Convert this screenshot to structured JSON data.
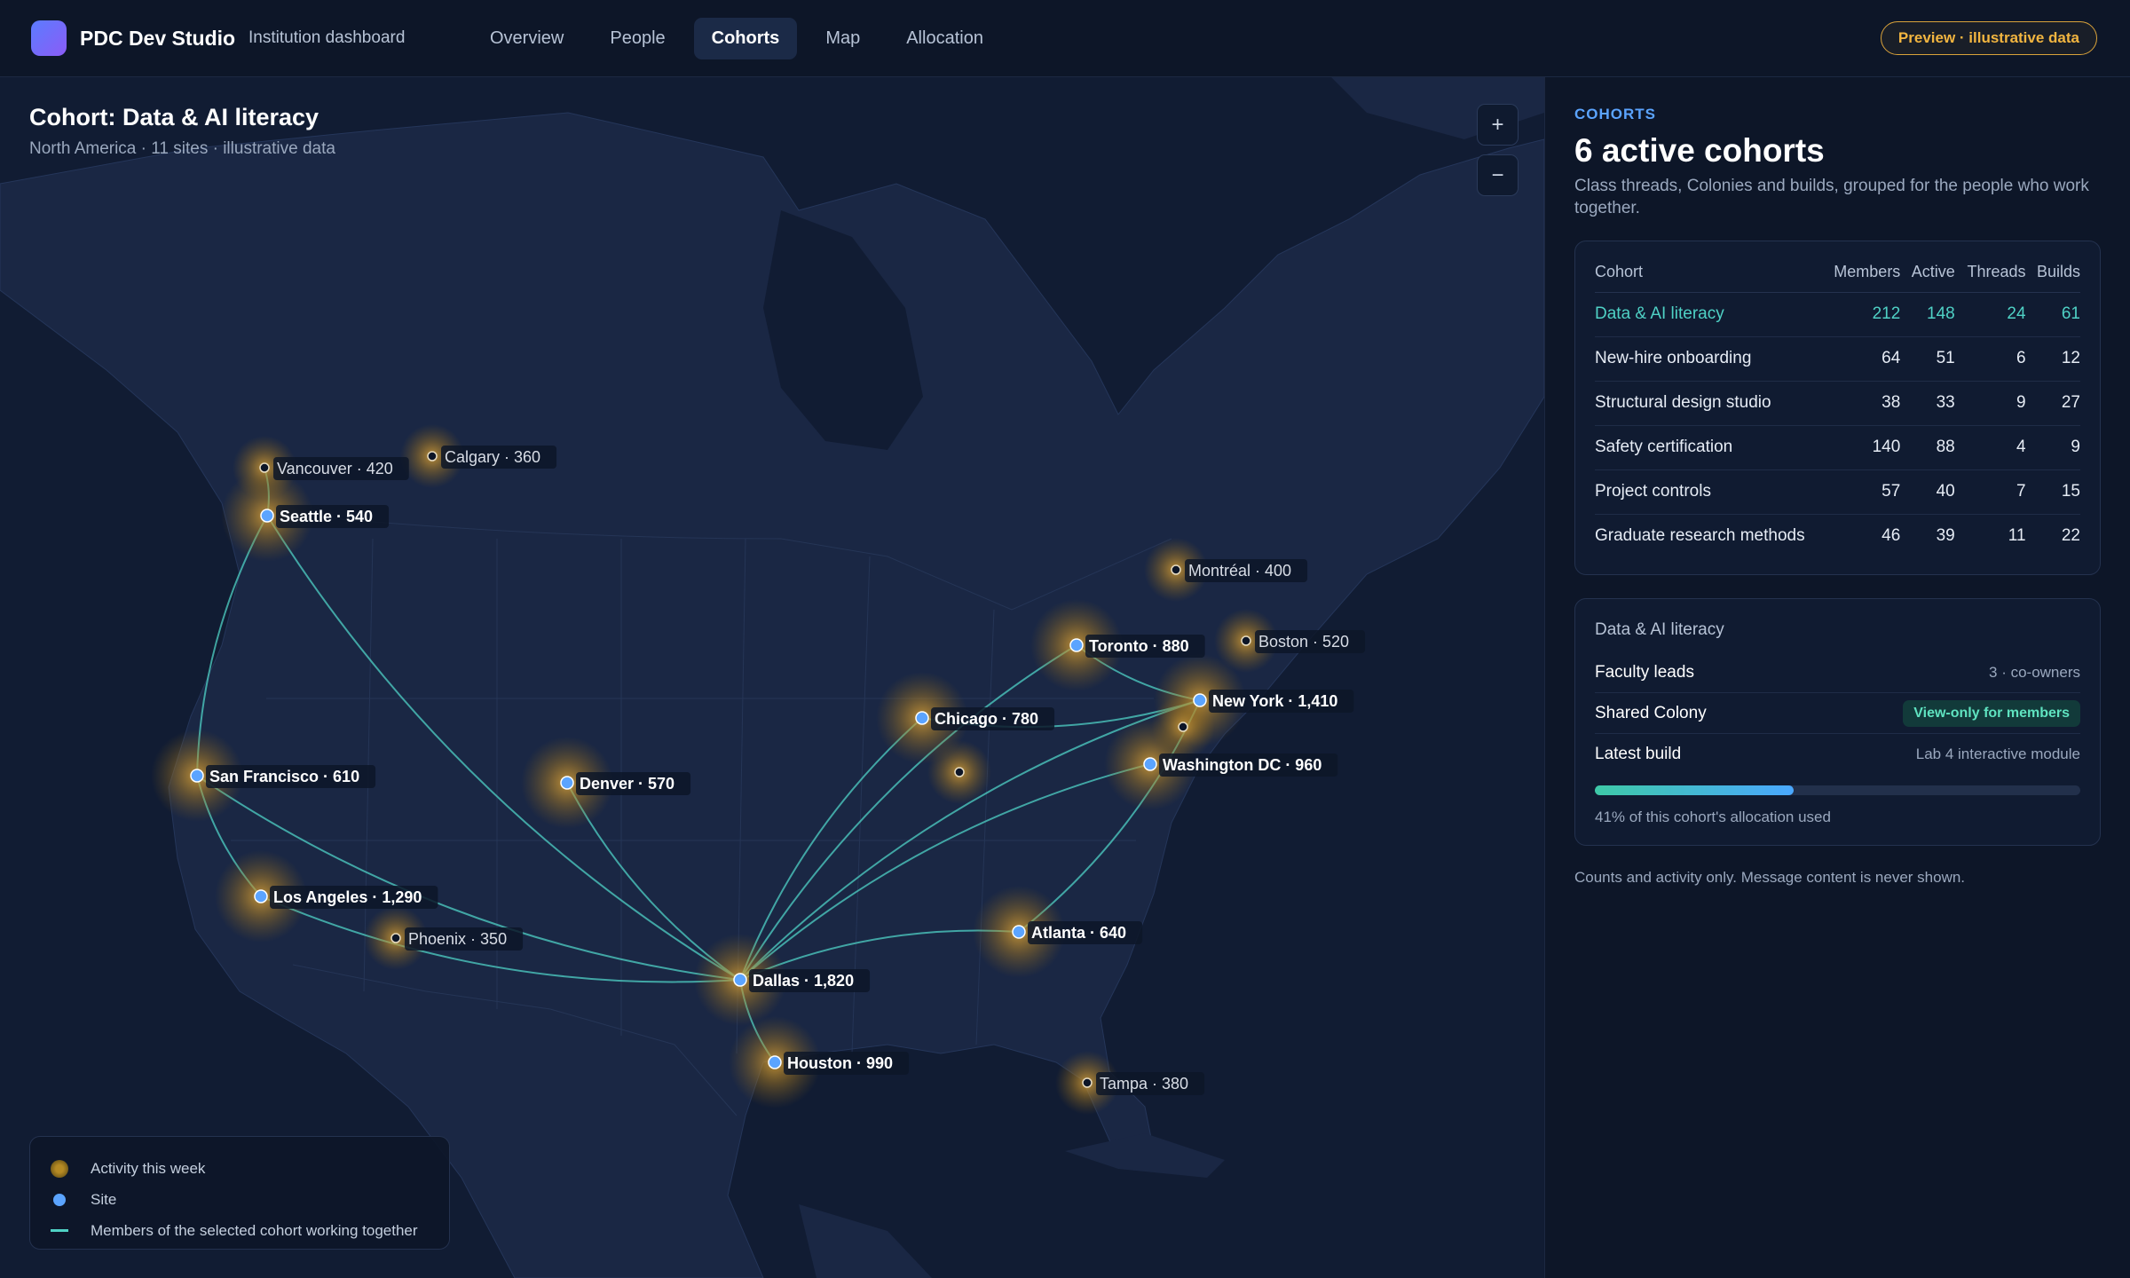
{
  "app": {
    "brand": "PDC Dev Studio",
    "subtitle": "Institution dashboard",
    "preview_badge": "Preview · illustrative data"
  },
  "nav": {
    "tabs": [
      {
        "label": "Overview",
        "active": false
      },
      {
        "label": "People",
        "active": false
      },
      {
        "label": "Cohorts",
        "active": true
      },
      {
        "label": "Map",
        "active": false
      },
      {
        "label": "Allocation",
        "active": false
      }
    ]
  },
  "map": {
    "title": "Cohort: Data & AI literacy",
    "subtitle": "North America · 11 sites · illustrative data",
    "zoom_in": "+",
    "zoom_out": "−",
    "sites": [
      {
        "id": "vancouver",
        "label": "Vancouver · 420",
        "type": "minor"
      },
      {
        "id": "calgary",
        "label": "Calgary · 360",
        "type": "minor"
      },
      {
        "id": "seattle",
        "label": "Seattle · 540",
        "type": "site"
      },
      {
        "id": "montreal",
        "label": "Montréal · 400",
        "type": "minor"
      },
      {
        "id": "boston",
        "label": "Boston · 520",
        "type": "minor"
      },
      {
        "id": "toronto",
        "label": "Toronto · 880",
        "type": "site"
      },
      {
        "id": "newyork",
        "label": "New York · 1,410",
        "type": "site"
      },
      {
        "id": "chicago",
        "label": "Chicago · 780",
        "type": "site"
      },
      {
        "id": "washington",
        "label": "Washington DC · 960",
        "type": "site"
      },
      {
        "id": "sanfrancisco",
        "label": "San Francisco · 610",
        "type": "site"
      },
      {
        "id": "denver",
        "label": "Denver · 570",
        "type": "site"
      },
      {
        "id": "losangeles",
        "label": "Los Angeles · 1,290",
        "type": "site"
      },
      {
        "id": "phoenix",
        "label": "Phoenix · 350",
        "type": "minor"
      },
      {
        "id": "atlanta",
        "label": "Atlanta · 640",
        "type": "site"
      },
      {
        "id": "dallas",
        "label": "Dallas · 1,820",
        "type": "site"
      },
      {
        "id": "houston",
        "label": "Houston · 990",
        "type": "site"
      },
      {
        "id": "tampa",
        "label": "Tampa · 380",
        "type": "minor"
      }
    ],
    "connections": [
      [
        "seattle",
        "sanfrancisco"
      ],
      [
        "seattle",
        "dallas"
      ],
      [
        "seattle",
        "vancouver"
      ],
      [
        "sanfrancisco",
        "losangeles"
      ],
      [
        "sanfrancisco",
        "dallas"
      ],
      [
        "losangeles",
        "dallas"
      ],
      [
        "denver",
        "dallas"
      ],
      [
        "chicago",
        "dallas"
      ],
      [
        "toronto",
        "dallas"
      ],
      [
        "newyork",
        "dallas"
      ],
      [
        "washington",
        "dallas"
      ],
      [
        "atlanta",
        "dallas"
      ],
      [
        "dallas",
        "houston"
      ],
      [
        "chicago",
        "newyork"
      ],
      [
        "toronto",
        "newyork"
      ],
      [
        "atlanta",
        "newyork"
      ]
    ],
    "legend": {
      "activity": "Activity this week",
      "site": "Site",
      "members": "Members of the selected cohort working together"
    },
    "colors": {
      "site": "#5ba4ff",
      "link": "#4fd1c5",
      "glow": "#d9a23a"
    }
  },
  "panel": {
    "kicker": "COHORTS",
    "title": "6 active cohorts",
    "description": "Class threads, Colonies and builds, grouped for the people who work together.",
    "table": {
      "headers": [
        "Cohort",
        "Members",
        "Active",
        "Threads",
        "Builds"
      ],
      "rows": [
        {
          "name": "Data & AI literacy",
          "members": "212",
          "active": "148",
          "threads": "24",
          "builds": "61",
          "selected": true
        },
        {
          "name": "New-hire onboarding",
          "members": "64",
          "active": "51",
          "threads": "6",
          "builds": "12"
        },
        {
          "name": "Structural design studio",
          "members": "38",
          "active": "33",
          "threads": "9",
          "builds": "27"
        },
        {
          "name": "Safety certification",
          "members": "140",
          "active": "88",
          "threads": "4",
          "builds": "9"
        },
        {
          "name": "Project controls",
          "members": "57",
          "active": "40",
          "threads": "7",
          "builds": "15"
        },
        {
          "name": "Graduate research methods",
          "members": "46",
          "active": "39",
          "threads": "11",
          "builds": "22"
        }
      ]
    },
    "detail": {
      "title": "Data & AI literacy",
      "faculty_label": "Faculty leads",
      "faculty_value": "3 · co-owners",
      "colony_label": "Shared Colony",
      "colony_badge": "View-only for members",
      "build_label": "Latest build",
      "build_value": "Lab 4 interactive module",
      "allocation_fraction": 0.41,
      "allocation_note": "41% of this cohort's allocation used"
    },
    "footnote": "Counts and activity only. Message content is never shown."
  }
}
